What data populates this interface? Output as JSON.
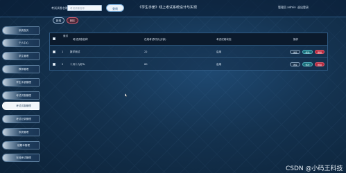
{
  "header": {
    "search_label": "考试试卷名称",
    "search_placeholder": "考试试卷名称",
    "search_button": "查询",
    "title": "《学生手册》线上考试系统设计与实现",
    "user": "管理员 admin",
    "logout": "退出登录"
  },
  "sidebar": {
    "items": [
      {
        "label": "系统首页"
      },
      {
        "label": "个人中心"
      },
      {
        "label": "学生管理"
      },
      {
        "label": "教师管理"
      },
      {
        "label": "学生手册管理"
      },
      {
        "label": "考试试卷管理"
      },
      {
        "label": "考试试卷管理"
      },
      {
        "label": "考试记录管理"
      },
      {
        "label": "系统管理"
      },
      {
        "label": "错题本管理"
      },
      {
        "label": "在线考试管理"
      }
    ],
    "active_index": 6
  },
  "toolbar": {
    "add_label": "新增",
    "delete_label": "删除"
  },
  "table": {
    "headers": [
      "索引",
      "考试试卷名称",
      "在线考试时长(分钟)",
      "考试试卷状态",
      "操作"
    ],
    "rows": [
      {
        "index": "1",
        "name": "数学测试",
        "duration": "22",
        "status": "启用"
      },
      {
        "index": "2",
        "name": "十月十九好么",
        "duration": "60",
        "status": "启用"
      }
    ],
    "actions": {
      "detail": "详情",
      "edit": "修改",
      "remove": "删除"
    }
  },
  "watermark": "CSDN @小码王科技"
}
